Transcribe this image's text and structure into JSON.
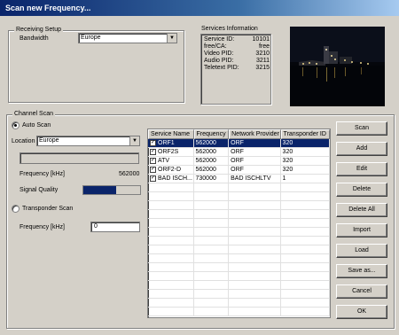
{
  "window": {
    "title": "Scan new Frequency..."
  },
  "receiving_setup": {
    "title": "Receiving Setup",
    "bandwidth_label": "Bandwidth",
    "bandwidth_value": "Europe"
  },
  "services_info": {
    "title": "Services Information",
    "rows": [
      {
        "label": "Service ID:",
        "value": "10101"
      },
      {
        "label": "free/CA:",
        "value": "free"
      },
      {
        "label": "Video PID:",
        "value": "3210"
      },
      {
        "label": "Audio PID:",
        "value": "3211"
      },
      {
        "label": "Teletext PID:",
        "value": "3215"
      }
    ]
  },
  "channel_scan": {
    "title": "Channel Scan",
    "auto_scan_label": "Auto Scan",
    "location_label": "Location",
    "location_value": "Europe",
    "frequency_label": "Frequency [kHz]",
    "frequency_value": "562000",
    "signal_quality_label": "Signal Quality",
    "signal_quality": 0.58,
    "transponder_scan_label": "Transponder Scan",
    "transponder_freq_label": "Frequency [kHz]",
    "transponder_freq_value": "0"
  },
  "table": {
    "columns": [
      "Service Name",
      "Frequency",
      "Network Provider",
      "Transponder ID"
    ],
    "rows": [
      {
        "name": "ORF1",
        "frequency": "562000",
        "provider": "ORF",
        "transponder": "320",
        "checked": true,
        "selected": true
      },
      {
        "name": "ORF2S",
        "frequency": "562000",
        "provider": "ORF",
        "transponder": "320",
        "checked": true,
        "selected": false
      },
      {
        "name": "ATV",
        "frequency": "562000",
        "provider": "ORF",
        "transponder": "320",
        "checked": true,
        "selected": false
      },
      {
        "name": "ORF2-D",
        "frequency": "562000",
        "provider": "ORF",
        "transponder": "320",
        "checked": true,
        "selected": false
      },
      {
        "name": "BAD ISCH...",
        "frequency": "730000",
        "provider": "BAD ISCHLTV",
        "transponder": "1",
        "checked": true,
        "selected": false
      }
    ]
  },
  "buttons": {
    "scan": "Scan",
    "add": "Add",
    "edit": "Edit",
    "delete": "Delete",
    "delete_all": "Delete All",
    "import": "Import",
    "load": "Load",
    "save_as": "Save as...",
    "cancel": "Cancel",
    "ok": "OK"
  },
  "colors": {
    "title_bar": "#0a246a",
    "selection": "#0a246a",
    "signal_bar": "#0a246a"
  }
}
